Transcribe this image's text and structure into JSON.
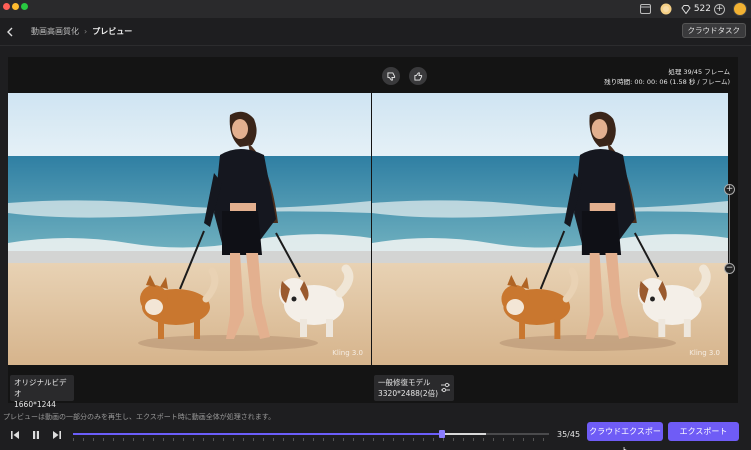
{
  "titlebar": {
    "credits": "522",
    "icons": [
      "window-icon",
      "coin-icon",
      "diamond-icon",
      "plus-icon",
      "avatar"
    ]
  },
  "header": {
    "breadcrumb_parent": "動画高画質化",
    "breadcrumb_sep": "›",
    "breadcrumb_current": "プレビュー",
    "cloud_task_label": "クラウドタスク"
  },
  "preview": {
    "status_line1": "処理 39/45 フレーム",
    "status_line2": "残り時間: 00: 00: 06 (1.58 秒 / フレーム)",
    "watermark": "Kling 3.0",
    "left_label": {
      "name": "オリジナルビデオ",
      "resolution": "1660*1244"
    },
    "right_label": {
      "name": "一般修復モデル",
      "resolution": "3320*2488(2倍)"
    },
    "zoom_plus": "+",
    "zoom_minus": "−"
  },
  "footer": {
    "notice": "プレビューは動画の一部分のみを再生し、エクスポート時に動画全体が処理されます。",
    "frame_counter": "35/45",
    "progress_fraction": 0.775,
    "buffer_fraction": 0.867,
    "cloud_export_label": "クラウドエクスポート",
    "export_label": "エクスポート"
  },
  "colors": {
    "accent": "#6f5cf6",
    "background": "#1e1e20"
  }
}
